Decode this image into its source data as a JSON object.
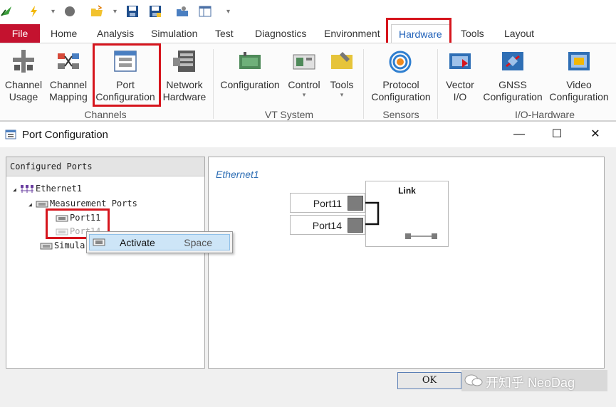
{
  "ribbon_tabs": {
    "file": "File",
    "home": "Home",
    "analysis": "Analysis",
    "simulation": "Simulation",
    "test": "Test",
    "diagnostics": "Diagnostics",
    "environment": "Environment",
    "hardware": "Hardware",
    "tools": "Tools",
    "layout": "Layout"
  },
  "ribbon": {
    "channel_usage": [
      "Channel",
      "Usage"
    ],
    "channel_mapping": [
      "Channel",
      "Mapping"
    ],
    "port_configuration": [
      "Port",
      "Configuration"
    ],
    "network_hardware": [
      "Network",
      "Hardware"
    ],
    "configuration": "Configuration",
    "control": "Control",
    "tools": "Tools",
    "protocol_configuration": [
      "Protocol",
      "Configuration"
    ],
    "vector_io": [
      "Vector",
      "I/O"
    ],
    "gnss_configuration": [
      "GNSS",
      "Configuration"
    ],
    "video_configuration": [
      "Video",
      "Configuration"
    ],
    "groups": {
      "channels": "Channels",
      "vt_system": "VT System",
      "sensors": "Sensors",
      "io_hardware": "I/O-Hardware"
    }
  },
  "dialog": {
    "title": "Port Configuration",
    "configured_ports_header": "Configured Ports",
    "tree": {
      "ethernet": "Ethernet1",
      "measurement_ports": "Measurement Ports",
      "port11": "Port11",
      "port14_partial": "Port14",
      "simulation_partial": "Simula"
    },
    "canvas": {
      "network_label": "Ethernet1",
      "port_a": "Port11",
      "port_b": "Port14",
      "link_label": "Link"
    },
    "context_menu": {
      "activate": "Activate",
      "shortcut": "Space"
    },
    "ok_button": "OK"
  },
  "watermark": "开知乎 NeoDag",
  "colors": {
    "file_tab": "#c4122f",
    "active_tab_text": "#1d5fb8",
    "highlight_box": "#d6151d",
    "menu_hover": "#cde5f7",
    "network_label": "#2f6fb5"
  }
}
